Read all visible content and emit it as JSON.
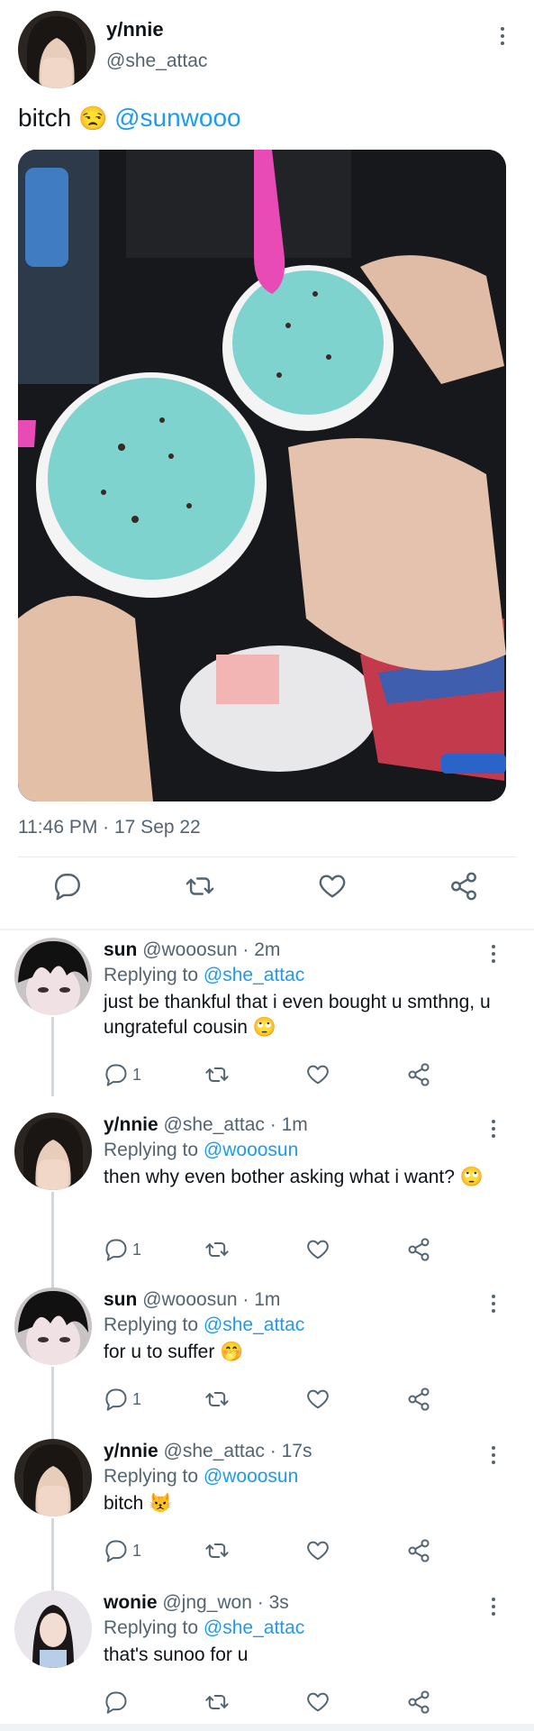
{
  "main_tweet": {
    "display_name": "y/nnie",
    "handle": "@she_attac",
    "text": "bitch",
    "emoji": "😒",
    "mention": "@sunwooo",
    "timestamp": "11:46 PM · 17 Sep 22",
    "avatar_icon": "avatar-photo",
    "photo_icon": "ice-cream-photo"
  },
  "replies": [
    {
      "display_name": "sun",
      "handle": "@wooosun",
      "age": "· 2m",
      "replying_label": "Replying to",
      "replying_to": "@she_attac",
      "text": "just be thankful that i even bought u smthng, u ungrateful cousin 🙄",
      "reply_count": "1"
    },
    {
      "display_name": "y/nnie",
      "handle": "@she_attac",
      "age": "· 1m",
      "replying_label": "Replying to",
      "replying_to": "@wooosun",
      "text": "then why even bother asking what i want? 🙄",
      "reply_count": "1"
    },
    {
      "display_name": "sun",
      "handle": "@wooosun",
      "age": "· 1m",
      "replying_label": "Replying to",
      "replying_to": "@she_attac",
      "text": "for u to suffer 🤭",
      "reply_count": "1"
    },
    {
      "display_name": "y/nnie",
      "handle": "@she_attac",
      "age": "· 17s",
      "replying_label": "Replying to",
      "replying_to": "@wooosun",
      "text": "bitch 😾",
      "reply_count": "1"
    },
    {
      "display_name": "wonie",
      "handle": "@jng_won",
      "age": "· 3s",
      "replying_label": "Replying to",
      "replying_to": "@she_attac",
      "text": "that's sunoo for u",
      "reply_count": ""
    }
  ],
  "colors": {
    "link": "#1d9bf0",
    "secondary_text": "#536471",
    "primary_text": "#0f1419",
    "divider": "#e6e9ec"
  },
  "icons": [
    "reply-icon",
    "retweet-icon",
    "like-icon",
    "share-icon",
    "more-icon"
  ]
}
